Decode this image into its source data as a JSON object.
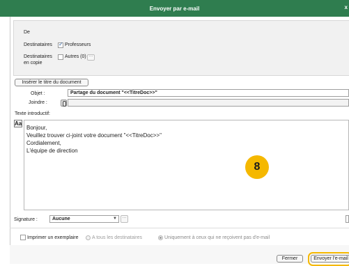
{
  "window": {
    "title": "Envoyer par e-mail",
    "close_glyph": "x"
  },
  "recipients": {
    "from_label": "De",
    "to_label": "Destinataires",
    "to_option": "Professeurs",
    "cc_label_line1": "Destinataires",
    "cc_label_line2": "en copie",
    "cc_option": "Autres (0)",
    "dots": "···"
  },
  "insert_title_button": "Insérer le titre du document",
  "subject": {
    "label": "Objet :",
    "value": "Partage du document \"<<TitreDoc>>\""
  },
  "attach": {
    "label": "Joindre :"
  },
  "intro": {
    "label": "Texte introductif:",
    "font_button": "Aa",
    "lines": [
      "Bonjour,",
      "Veuillez trouver ci-joint votre document \"<<TitreDoc>>\"",
      "Cordialement,",
      "L'équipe de direction"
    ]
  },
  "step_badge": "8",
  "signature": {
    "label": "Signature :",
    "value": "Aucune",
    "arrow": "▼",
    "dots": "···"
  },
  "options": {
    "print_copy": "Imprimer un exemplaire",
    "all_recipients": "A tous les destinataires",
    "only_without_email": "Uniquement à ceux qui ne reçoivent pas d'e-mail"
  },
  "footer": {
    "close_button": "Fermer",
    "send_button": "Envoyer l'e-mail"
  },
  "colors": {
    "titlebar": "#2f7d4f",
    "highlight": "#f5b800"
  }
}
